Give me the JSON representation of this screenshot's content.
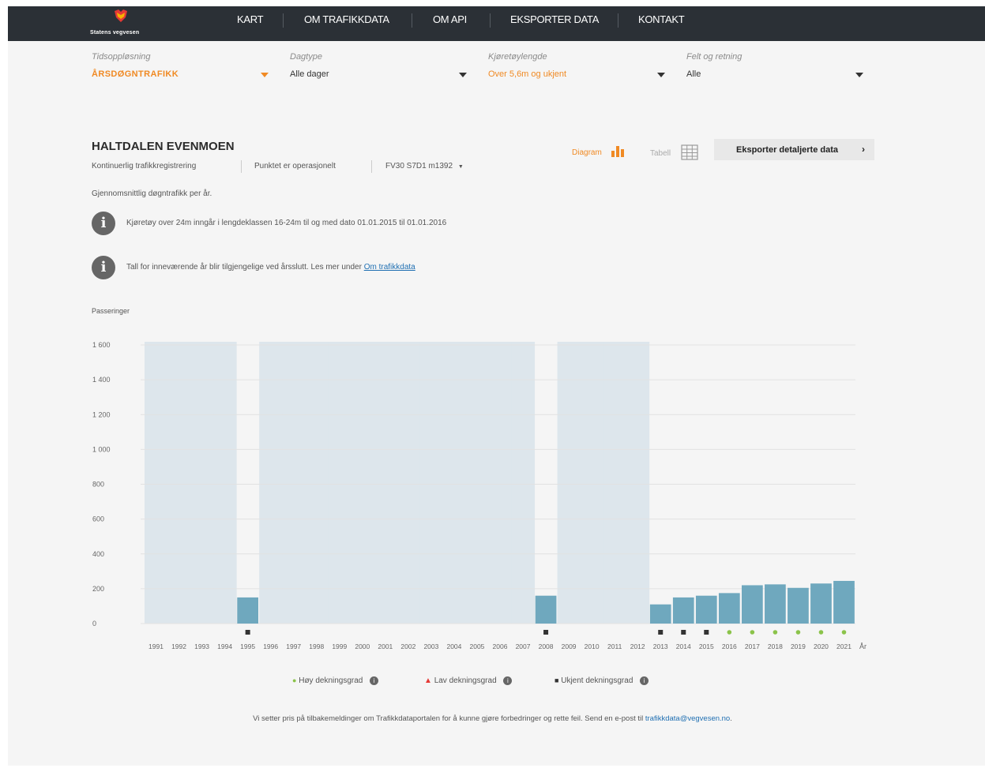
{
  "nav": {
    "logo_text": "Statens vegvesen",
    "items": [
      "KART",
      "OM TRAFIKKDATA",
      "OM API",
      "EKSPORTER DATA",
      "KONTAKT"
    ]
  },
  "filters": [
    {
      "label": "Tidsoppløsning",
      "value": "ÅRSDØGNTRAFIKK"
    },
    {
      "label": "Dagtype",
      "value": "Alle dager"
    },
    {
      "label": "Kjøretøylengde",
      "value": "Over 5,6m og ukjent"
    },
    {
      "label": "Felt og retning",
      "value": "Alle"
    }
  ],
  "station": {
    "name": "HALTDALEN EVENMOEN",
    "registration_type": "Kontinuerlig trafikkregistrering",
    "operational_status": "Punktet er operasjonelt",
    "road_reference": "FV30 S7D1 m1392",
    "subtitle": "Gjennomsnittlig døgntrafikk per år."
  },
  "view_toggle": {
    "diagram": "Diagram",
    "table": "Tabell"
  },
  "export_label": "Eksporter detaljerte data",
  "infos": [
    {
      "text": "Kjøretøy over 24m inngår i lengdeklassen 16-24m til og med dato 01.01.2015 til 01.01.2016"
    },
    {
      "text": "Tall for inneværende år blir tilgjengelige ved årsslutt. Les mer under ",
      "link": "Om trafikkdata"
    }
  ],
  "chart_data": {
    "type": "bar",
    "ylabel": "Passeringer",
    "xlabel": "År",
    "ylim": [
      0,
      1600
    ],
    "y_ticks": [
      "1 600",
      "1 400",
      "1 200",
      "1 000",
      "800",
      "600",
      "400",
      "200",
      "0"
    ],
    "y_tick_values": [
      1600,
      1400,
      1200,
      1000,
      800,
      600,
      400,
      200,
      0
    ],
    "categories": [
      "1991",
      "1992",
      "1993",
      "1994",
      "1995",
      "1996",
      "1997",
      "1998",
      "1999",
      "2000",
      "2001",
      "2002",
      "2003",
      "2004",
      "2005",
      "2006",
      "2007",
      "2008",
      "2009",
      "2010",
      "2011",
      "2012",
      "2013",
      "2014",
      "2015",
      "2016",
      "2017",
      "2018",
      "2019",
      "2020",
      "2021"
    ],
    "values": [
      null,
      null,
      null,
      null,
      150,
      null,
      null,
      null,
      null,
      null,
      null,
      null,
      null,
      null,
      null,
      null,
      null,
      160,
      null,
      null,
      null,
      null,
      110,
      150,
      160,
      175,
      220,
      225,
      205,
      230,
      245
    ],
    "missing_data_years": [
      "1991",
      "1992",
      "1993",
      "1994",
      "1996",
      "1997",
      "1998",
      "1999",
      "2000",
      "2001",
      "2002",
      "2003",
      "2004",
      "2005",
      "2006",
      "2007",
      "2009",
      "2010",
      "2011",
      "2012"
    ],
    "coverage": [
      null,
      null,
      null,
      null,
      "unknown",
      null,
      null,
      null,
      null,
      null,
      null,
      null,
      null,
      null,
      null,
      null,
      null,
      "unknown",
      null,
      null,
      null,
      null,
      "unknown",
      "unknown",
      "unknown",
      "high",
      "high",
      "high",
      "high",
      "high",
      "high"
    ],
    "legend": [
      {
        "label": "Høy dekningsgrad",
        "symbol": "circle",
        "color": "#8bc34a"
      },
      {
        "label": "Lav dekningsgrad",
        "symbol": "triangle",
        "color": "#e53935"
      },
      {
        "label": "Ukjent dekningsgrad",
        "symbol": "square",
        "color": "#333333"
      }
    ],
    "bar_color": "#6fa8be",
    "missing_color": "#dde6ec"
  },
  "footer": {
    "text": "Vi setter pris på tilbakemeldinger om Trafikkdataportalen for å kunne gjøre forbedringer og rette feil. Send en e-post til ",
    "email": "trafikkdata@vegvesen.no",
    "end": "."
  },
  "colors": {
    "nav_bg": "#2b3036",
    "accent": "#f08a24",
    "link": "#1f6fb2"
  }
}
